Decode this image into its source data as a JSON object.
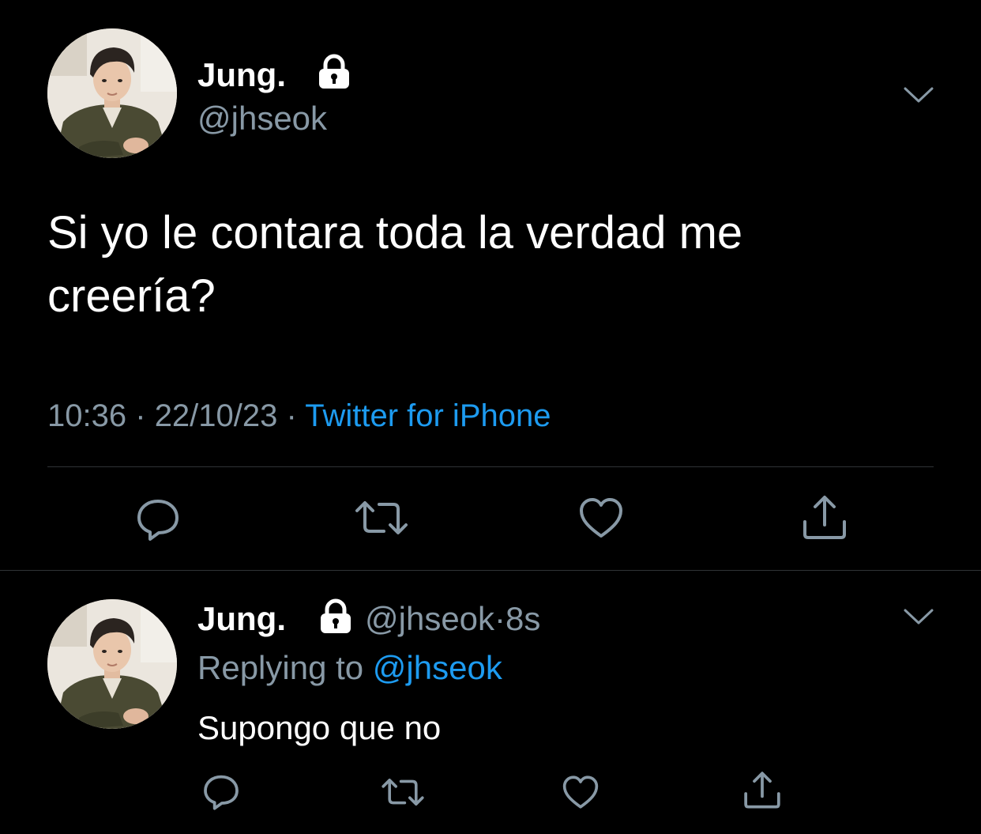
{
  "main_tweet": {
    "display_name": "Jung.",
    "handle": "@jhseok",
    "text": "Si yo le contara toda la verdad me creería?",
    "time": "10:36",
    "separator": "·",
    "date": "22/10/23",
    "source": "Twitter for iPhone",
    "avatar_icon": "profile-photo",
    "protected_icon": "lock-icon"
  },
  "reply_tweet": {
    "display_name": "Jung.",
    "handle": "@jhseok",
    "separator": "·",
    "time_ago": "8s",
    "replying_prefix": "Replying to",
    "replying_to": "@jhseok",
    "text": "Supongo que no",
    "avatar_icon": "profile-photo",
    "protected_icon": "lock-icon"
  },
  "actions": [
    "reply-icon",
    "retweet-icon",
    "like-icon",
    "share-icon"
  ],
  "colors": {
    "background": "#000000",
    "text": "#ffffff",
    "secondary": "#8899a6",
    "accent": "#1d9bf0",
    "divider": "#2f3336"
  }
}
